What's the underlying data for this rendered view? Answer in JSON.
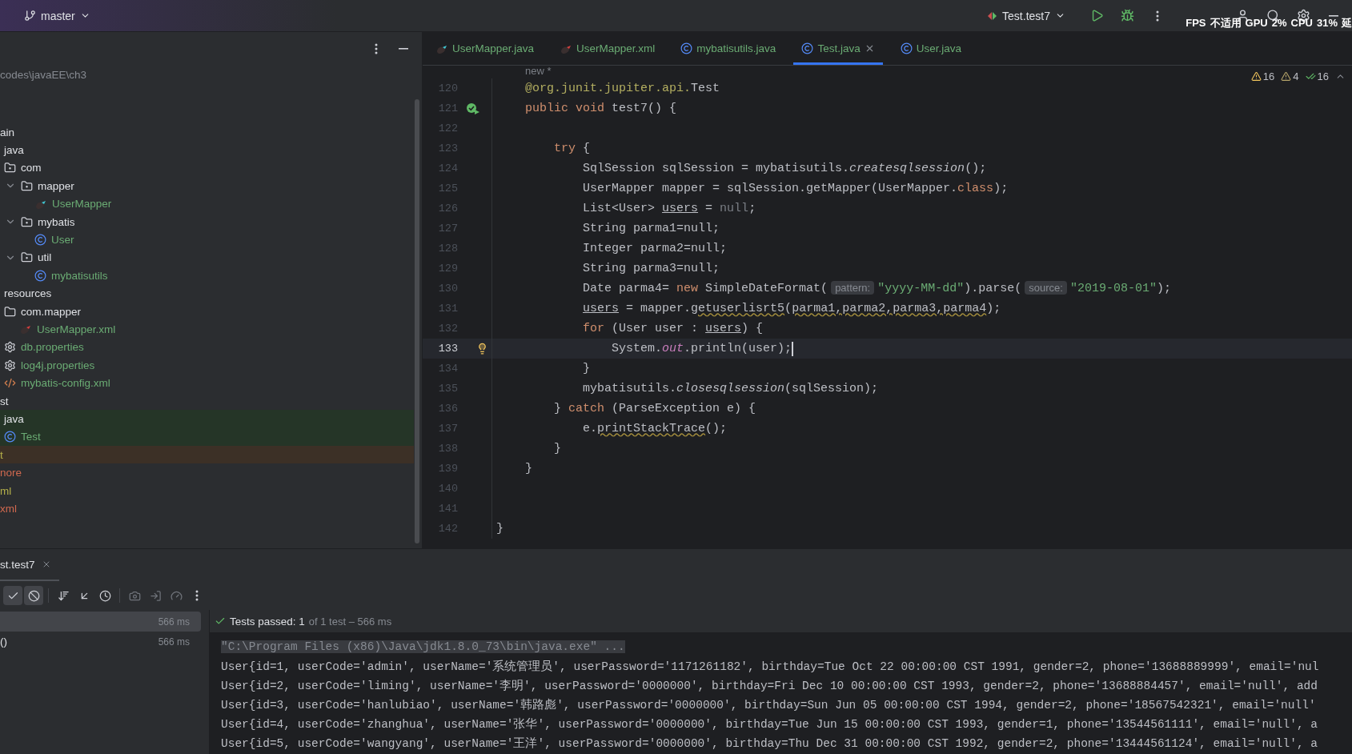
{
  "top_bar": {
    "branch": "master",
    "run_config": "Test.test7",
    "overlay": [
      "FPS",
      "不适用",
      "GPU",
      "2%",
      "CPU",
      "31%",
      "延"
    ]
  },
  "project_tree": {
    "path": "codes\\javaEE\\ch3",
    "items": [
      {
        "label": "ain",
        "excluded": false,
        "children": [
          {
            "label": "java",
            "children": [
              {
                "label": "com",
                "kind": "package",
                "children": [
                  {
                    "label": "mapper",
                    "kind": "package",
                    "expanded": true,
                    "children": [
                      {
                        "label": "UserMapper",
                        "kind": "mapper",
                        "color": "#6aab73"
                      }
                    ]
                  },
                  {
                    "label": "mybatis",
                    "kind": "package",
                    "expanded": true,
                    "children": [
                      {
                        "label": "User",
                        "kind": "class",
                        "color": "#6aab73"
                      }
                    ]
                  },
                  {
                    "label": "util",
                    "kind": "package",
                    "expanded": true,
                    "children": [
                      {
                        "label": "mybatisutils",
                        "kind": "class",
                        "color": "#6aab73"
                      }
                    ]
                  }
                ]
              }
            ]
          },
          {
            "label": "resources",
            "children": [
              {
                "label": "com.mapper",
                "kind": "folder",
                "children": [
                  {
                    "label": "UserMapper.xml",
                    "kind": "mapper-xml",
                    "color": "#6aab73"
                  }
                ]
              },
              {
                "label": "db.properties",
                "kind": "properties",
                "color": "#6aab73"
              },
              {
                "label": "log4j.properties",
                "kind": "properties",
                "color": "#6aab73"
              },
              {
                "label": "mybatis-config.xml",
                "kind": "xml",
                "color": "#6aab73"
              }
            ]
          }
        ]
      },
      {
        "label": "st",
        "excluded": false,
        "children": [
          {
            "label": "java",
            "test_source": true,
            "children": [
              {
                "label": "Test",
                "kind": "class",
                "color": "#6aab73"
              }
            ]
          }
        ]
      },
      {
        "label": "t",
        "color": "#b5b04a",
        "excluded": true
      },
      {
        "label": "nore",
        "color": "#d1694f",
        "excluded": false
      },
      {
        "label": "ml",
        "color": "#b5b04a",
        "excluded": false
      },
      {
        "label": "xml",
        "color": "#d1694f",
        "excluded": false
      }
    ]
  },
  "editor_tabs": [
    {
      "label": "UserMapper.java",
      "kind": "mapper",
      "selected": false
    },
    {
      "label": "UserMapper.xml",
      "kind": "mapper-xml",
      "selected": false
    },
    {
      "label": "mybatisutils.java",
      "kind": "class",
      "selected": false
    },
    {
      "label": "Test.java",
      "kind": "class",
      "selected": true
    },
    {
      "label": "User.java",
      "kind": "class",
      "selected": false
    }
  ],
  "editor": {
    "top_fragment": "new *",
    "inspections": [
      {
        "kind": "warning",
        "count": "16"
      },
      {
        "kind": "weak",
        "count": "4"
      },
      {
        "kind": "ok",
        "count": "16"
      }
    ],
    "lines": [
      {
        "number": "120",
        "kind": "plain",
        "current": false,
        "code": [
          {
            "kind": "ann",
            "text": "    @org.junit.jupiter.api."
          },
          {
            "kind": "plain",
            "text": "Test"
          }
        ]
      },
      {
        "number": "121",
        "kind": "run",
        "current": false,
        "code": [
          {
            "kind": "kw",
            "text": "    public void "
          },
          {
            "kind": "plain",
            "text": "test7() {"
          }
        ]
      },
      {
        "number": "122",
        "kind": "plain",
        "current": false
      },
      {
        "number": "123",
        "kind": "plain",
        "current": false,
        "code": [
          {
            "kind": "kw",
            "text": "        try"
          },
          {
            "kind": "plain",
            "text": " {"
          }
        ]
      },
      {
        "number": "124",
        "kind": "plain",
        "current": false,
        "code": [
          {
            "kind": "plain",
            "text": "            SqlSession sqlSession = mybatisutils."
          },
          {
            "kind": "italic",
            "text": "createsqlsession"
          },
          {
            "kind": "plain",
            "text": "();"
          }
        ]
      },
      {
        "number": "125",
        "kind": "plain",
        "current": false,
        "code": [
          {
            "kind": "plain",
            "text": "            UserMapper mapper = sqlSession.getMapper(UserMapper."
          },
          {
            "kind": "kw",
            "text": "class"
          },
          {
            "kind": "plain",
            "text": ");"
          }
        ]
      },
      {
        "number": "126",
        "kind": "plain",
        "current": false,
        "code": [
          {
            "kind": "plain",
            "text": "            List<User> "
          },
          {
            "kind": "under",
            "text": "users"
          },
          {
            "kind": "plain",
            "text": " = "
          },
          {
            "kind": "faded",
            "text": "null"
          },
          {
            "kind": "plain",
            "text": ";"
          }
        ]
      },
      {
        "number": "127",
        "kind": "plain",
        "current": false,
        "code": [
          {
            "kind": "plain",
            "text": "            String parma1=null;"
          }
        ]
      },
      {
        "number": "128",
        "kind": "plain",
        "current": false,
        "code": [
          {
            "kind": "plain",
            "text": "            Integer parma2=null;"
          }
        ]
      },
      {
        "number": "129",
        "kind": "plain",
        "current": false,
        "code": [
          {
            "kind": "plain",
            "text": "            String parma3=null;"
          }
        ]
      },
      {
        "number": "130",
        "kind": "plain",
        "current": false,
        "code": [
          {
            "kind": "plain",
            "text": "            Date parma4= "
          },
          {
            "kind": "kw",
            "text": "new"
          },
          {
            "kind": "plain",
            "text": " SimpleDateFormat("
          },
          {
            "kind": "hint",
            "text": "pattern:"
          },
          {
            "kind": "str",
            "text": "\"yyyy-MM-dd\""
          },
          {
            "kind": "plain",
            "text": ").parse("
          },
          {
            "kind": "hint",
            "text": "source:"
          },
          {
            "kind": "str",
            "text": "\"2019-08-01\""
          },
          {
            "kind": "plain",
            "text": ");"
          }
        ]
      },
      {
        "number": "131",
        "kind": "plain",
        "current": false,
        "code": [
          {
            "kind": "under",
            "text": "            users"
          },
          {
            "kind": "plain",
            "text": " = mapper."
          },
          {
            "kind": "wavy",
            "text": "getuserlisrt5"
          },
          {
            "kind": "plain",
            "text": "("
          },
          {
            "kind": "wavy",
            "text": "parma1,parma2,parma3,parma4"
          },
          {
            "kind": "plain",
            "text": ");"
          }
        ]
      },
      {
        "number": "132",
        "kind": "plain",
        "current": false,
        "code": [
          {
            "kind": "kw",
            "text": "            for"
          },
          {
            "kind": "plain",
            "text": " (User user : "
          },
          {
            "kind": "under",
            "text": "users"
          },
          {
            "kind": "plain",
            "text": ") {"
          }
        ]
      },
      {
        "number": "133",
        "kind": "intention",
        "current": true,
        "code": [
          {
            "kind": "plain",
            "text": "                System."
          },
          {
            "kind": "field",
            "text": "out"
          },
          {
            "kind": "plain",
            "text": ".println(user);"
          }
        ]
      },
      {
        "number": "134",
        "kind": "plain",
        "current": false,
        "code": [
          {
            "kind": "plain",
            "text": "            }"
          }
        ]
      },
      {
        "number": "135",
        "kind": "plain",
        "current": false,
        "code": [
          {
            "kind": "plain",
            "text": "            mybatisutils."
          },
          {
            "kind": "italic",
            "text": "closesqlsession"
          },
          {
            "kind": "plain",
            "text": "(sqlSession);"
          }
        ]
      },
      {
        "number": "136",
        "kind": "plain",
        "current": false,
        "code": [
          {
            "kind": "plain",
            "text": "        } "
          },
          {
            "kind": "kw",
            "text": "catch"
          },
          {
            "kind": "plain",
            "text": " (ParseException e) {"
          }
        ]
      },
      {
        "number": "137",
        "kind": "plain",
        "current": false,
        "code": [
          {
            "kind": "plain",
            "text": "            e."
          },
          {
            "kind": "wavy",
            "text": "printStackTrace"
          },
          {
            "kind": "plain",
            "text": "();"
          }
        ]
      },
      {
        "number": "138",
        "kind": "plain",
        "current": false,
        "code": [
          {
            "kind": "plain",
            "text": "        }"
          }
        ]
      },
      {
        "number": "139",
        "kind": "plain",
        "current": false,
        "code": [
          {
            "kind": "plain",
            "text": "    }"
          }
        ]
      },
      {
        "number": "140",
        "kind": "plain",
        "current": false
      },
      {
        "number": "141",
        "kind": "plain",
        "current": false
      },
      {
        "number": "142",
        "kind": "plain",
        "current": false,
        "code": [
          {
            "kind": "plain",
            "text": "}"
          }
        ]
      }
    ]
  },
  "run_panel": {
    "tab": "st.test7",
    "toolbar": [
      {
        "kind": "check",
        "selected": true
      },
      {
        "kind": "ban",
        "selected": true
      },
      {
        "kind": "sort",
        "selected": false
      },
      {
        "kind": "collapse",
        "selected": false
      },
      {
        "kind": "history",
        "selected": false
      },
      {
        "kind": "camera",
        "selected": false
      },
      {
        "kind": "import",
        "selected": false
      },
      {
        "kind": "gauge",
        "selected": false
      },
      {
        "kind": "more",
        "selected": false
      }
    ],
    "tests": [
      {
        "time": "566 ms",
        "selected": true
      },
      {
        "name": "()",
        "time": "566 ms",
        "selected": false
      }
    ],
    "status": {
      "label": "Tests passed: 1",
      "detail": "of 1 test – 566 ms"
    },
    "console": [
      {
        "kind": "command",
        "text": "\"C:\\Program Files (x86)\\Java\\jdk1.8.0_73\\bin\\java.exe\" ..."
      },
      {
        "kind": "output",
        "text": "User{id=1, userCode='admin', userName='系统管理员', userPassword='1171261182', birthday=Tue Oct 22 00:00:00 CST 1991, gender=2, phone='13688889999', email='nul"
      },
      {
        "kind": "output",
        "text": "User{id=2, userCode='liming', userName='李明', userPassword='0000000', birthday=Fri Dec 10 00:00:00 CST 1993, gender=2, phone='13688884457', email='null', add"
      },
      {
        "kind": "output",
        "text": "User{id=3, userCode='hanlubiao', userName='韩路彪', userPassword='0000000', birthday=Sun Jun 05 00:00:00 CST 1994, gender=2, phone='18567542321', email='null'"
      },
      {
        "kind": "output",
        "text": "User{id=4, userCode='zhanghua', userName='张华', userPassword='0000000', birthday=Tue Jun 15 00:00:00 CST 1993, gender=1, phone='13544561111', email='null', a"
      },
      {
        "kind": "output",
        "text": "User{id=5, userCode='wangyang', userName='王洋', userPassword='0000000', birthday=Thu Dec 31 00:00:00 CST 1992, gender=2, phone='13444561124', email='null', a"
      }
    ]
  }
}
